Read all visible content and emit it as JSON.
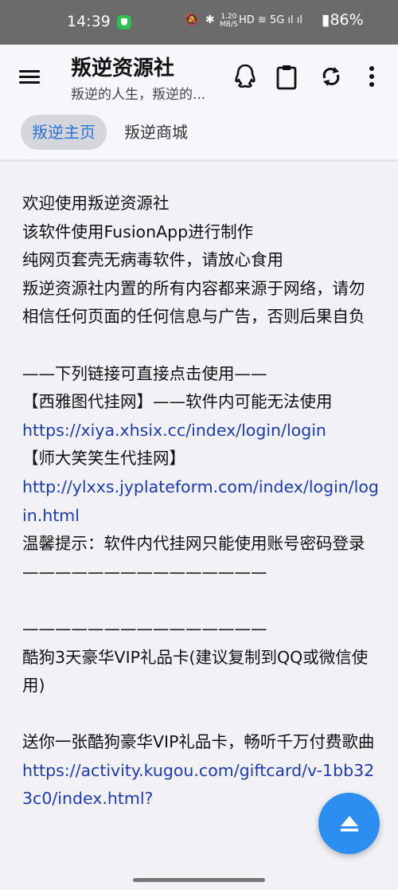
{
  "status_bar": {
    "time": "14:39",
    "speed_top": "1.20",
    "speed_bottom": "MB/S",
    "icons": "🔕 ✱",
    "signal_text": "HD ≋ 5G ıl ıl",
    "battery": "▮86%"
  },
  "app_bar": {
    "title": "叛逆资源社",
    "subtitle": "叛逆的人生，叛逆的...",
    "icons": [
      "menu-icon",
      "qq-icon",
      "clipboard-icon",
      "refresh-icon",
      "more-icon"
    ]
  },
  "tabs": [
    {
      "label": "叛逆主页",
      "selected": true
    },
    {
      "label": "叛逆商城",
      "selected": false
    }
  ],
  "content": {
    "line1": "欢迎使用叛逆资源社",
    "line2": "该软件使用FusionApp进行制作",
    "line3": "纯网页套壳无病毒软件，请放心食用",
    "line4": "叛逆资源社内置的所有内容都来源于网络，请勿相信任何页面的任何信息与广告，否则后果自负",
    "line5": "——下列链接可直接点击使用——",
    "line6": "【西雅图代挂网】——软件内可能无法使用",
    "link1": "https://xiya.xhsix.cc/index/login/login",
    "line7": "【师大笑笑生代挂网】",
    "link2": "http://ylxxs.jyplateform.com/index/login/login.html",
    "line8": "温馨提示：软件内代挂网只能使用账号密码登录",
    "sep1": "———————————————",
    "sep2": "———————————————",
    "line9": "酷狗3天豪华VIP礼品卡(建议复制到QQ或微信使用)",
    "line10_text": "送你一张酷狗豪华VIP礼品卡，畅听千万付费歌曲",
    "link3": "https://activity.kugou.com/giftcard/v-1bb323c0/index.html?"
  },
  "colors": {
    "accent": "#2a73d9",
    "link": "#1b3bb3",
    "fab": "#2c8ef0"
  }
}
